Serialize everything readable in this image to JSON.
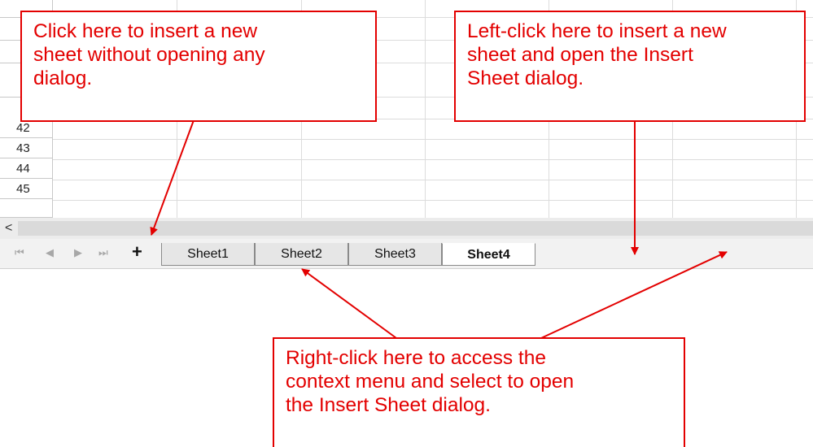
{
  "grid": {
    "row_numbers": [
      "42",
      "43",
      "44",
      "45"
    ]
  },
  "scrollbar": {
    "left_arrow": "<"
  },
  "tabbar": {
    "nav_first": "⏮",
    "nav_prev": "◀",
    "nav_next": "▶",
    "nav_last": "⏭",
    "add_sheet_label": "+",
    "tabs": [
      {
        "label": "Sheet1",
        "active": false
      },
      {
        "label": "Sheet2",
        "active": false
      },
      {
        "label": "Sheet3",
        "active": false
      },
      {
        "label": "Sheet4",
        "active": true
      }
    ]
  },
  "callouts": {
    "add_sheet_text": "Click here to insert a new\nsheet without opening any\ndialog.",
    "empty_area_text": "Left-click here to insert a new\nsheet and open the Insert\nSheet dialog.",
    "right_click_text": "Right-click here to access the\ncontext menu and select to open\nthe Insert Sheet dialog."
  },
  "colors": {
    "annotation": "#e30000",
    "active_tab": "#ffffff",
    "inactive_tab": "#e6e6e6"
  }
}
